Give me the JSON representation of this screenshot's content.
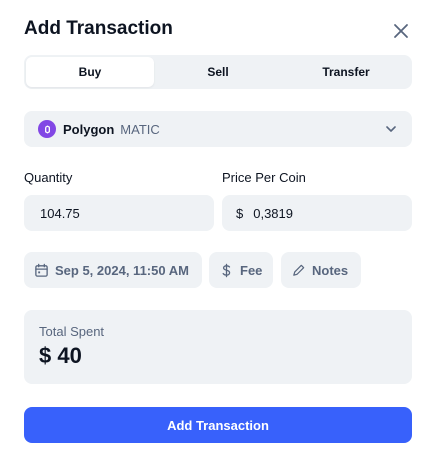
{
  "modal": {
    "title": "Add Transaction"
  },
  "tabs": [
    {
      "label": "Buy",
      "active": true
    },
    {
      "label": "Sell",
      "active": false
    },
    {
      "label": "Transfer",
      "active": false
    }
  ],
  "coin": {
    "name": "Polygon",
    "symbol": "MATIC",
    "icon": "polygon-icon",
    "icon_color": "#8247e5"
  },
  "quantity": {
    "label": "Quantity",
    "value": "104.75"
  },
  "price": {
    "label": "Price Per Coin",
    "currency": "$",
    "value": "0,3819"
  },
  "chips": {
    "date": "Sep 5, 2024, 11:50 AM",
    "fee": "Fee",
    "notes": "Notes"
  },
  "total": {
    "label": "Total Spent",
    "value": "$ 40"
  },
  "submit": {
    "label": "Add Transaction",
    "color": "#3861fb"
  },
  "colors": {
    "panel_bg": "#eff2f5",
    "text_primary": "#0d1421",
    "text_secondary": "#58667e"
  }
}
